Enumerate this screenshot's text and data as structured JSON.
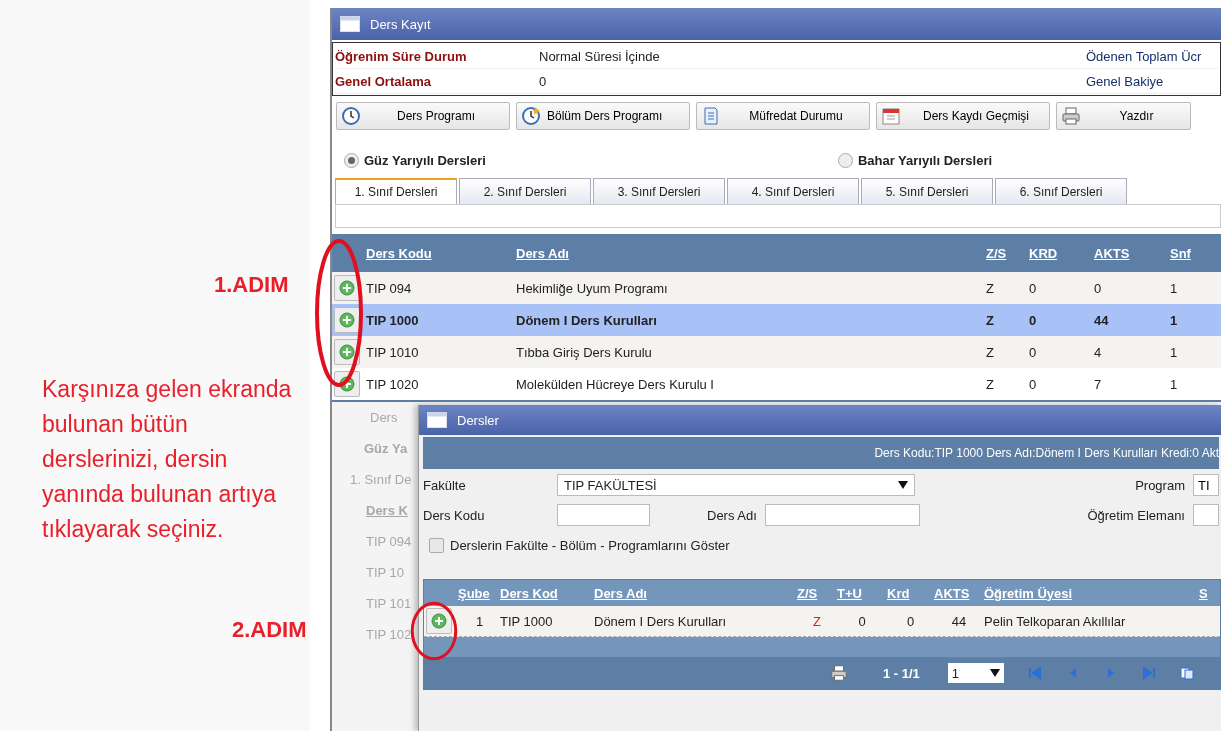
{
  "annotations": {
    "step_1": "1.ADIM",
    "step_2": "2.ADIM",
    "instruction": "Karşınıza gelen ekranda bulunan bütün derslerinizi, dersin yanında bulunan artıya tıklayarak seçiniz."
  },
  "window": {
    "title": "Ders Kayıt"
  },
  "info": [
    {
      "label": "Öğrenim Süre Durum",
      "value": "Normal Süresi İçinde",
      "right": "Ödenen Toplam Ücr"
    },
    {
      "label": "Genel Ortalama",
      "value": "0",
      "right": "Genel Bakiye"
    }
  ],
  "toolbar": [
    {
      "label": "Ders Programı",
      "kind": "clock"
    },
    {
      "label": "Bölüm Ders Programı",
      "kind": "clock-star"
    },
    {
      "label": "Müfredat Durumu",
      "kind": "document"
    },
    {
      "label": "Ders Kaydı Geçmişi",
      "kind": "calendar"
    },
    {
      "label": "Yazdır",
      "kind": "printer"
    }
  ],
  "semesters": [
    {
      "label": "Güz Yarıyılı Dersleri",
      "selected": true
    },
    {
      "label": "Bahar Yarıyılı Dersleri",
      "selected": false
    }
  ],
  "tabs": [
    {
      "label": "1. Sınıf Dersleri",
      "selected": true
    },
    {
      "label": "2. Sınıf Dersleri",
      "selected": false
    },
    {
      "label": "3. Sınıf Dersleri",
      "selected": false
    },
    {
      "label": "4. Sınıf Dersleri",
      "selected": false
    },
    {
      "label": "5. Sınıf Dersleri",
      "selected": false
    },
    {
      "label": "6. Sınıf Dersleri",
      "selected": false
    }
  ],
  "table": {
    "columns": [
      "Ders Kodu",
      "Ders Adı",
      "Z/S",
      "KRD",
      "AKTS",
      "Snf"
    ],
    "rows": [
      {
        "cells": [
          "TIP 094",
          "Hekimliğe Uyum Programı",
          "Z",
          "0",
          "0",
          "1"
        ],
        "selected": false
      },
      {
        "cells": [
          "TIP 1000",
          "Dönem I Ders Kurulları",
          "Z",
          "0",
          "44",
          "1"
        ],
        "selected": true
      },
      {
        "cells": [
          "TIP 1010",
          "Tıbba Giriş Ders Kurulu",
          "Z",
          "0",
          "4",
          "1"
        ],
        "selected": false
      },
      {
        "cells": [
          "TIP 1020",
          "Molekülden Hücreye Ders Kurulu I",
          "Z",
          "0",
          "7",
          "1"
        ],
        "selected": false
      }
    ]
  },
  "background_fragments": {
    "button": "Ders",
    "radio": "Güz Ya",
    "tab": "1. Sınıf De",
    "header": "Ders K",
    "rows": [
      "TIP 094",
      "TIP 10",
      "TIP 101",
      "TIP 102"
    ]
  },
  "dialog": {
    "title": "Dersler",
    "info": "Ders Kodu:TIP 1000 Ders Adı:Dönem I Ders Kurulları Kredi:0 Akt",
    "faculty_label": "Fakülte",
    "faculty_value": "TIP FAKÜLTESİ",
    "program_label": "Program",
    "program_value": "TI",
    "code_label": "Ders Kodu",
    "name_label": "Ders Adı",
    "teacher_label": "Öğretim Elemanı",
    "show_checkbox": {
      "label": "Derslerin Fakülte - Bölüm - Programlarını Göster",
      "checked": false
    },
    "columns": [
      "Şube",
      "Ders Kod",
      "Ders Adı",
      "Z/S",
      "T+U",
      "Krd",
      "AKTS",
      "Öğretim Üyesi",
      "S"
    ],
    "rows": [
      {
        "cells": [
          "1",
          "TIP 1000",
          "Dönem I Ders Kurulları",
          "Z",
          "0",
          "0",
          "44",
          "Pelin Telkoparan Akıllılar"
        ]
      }
    ],
    "pager": {
      "range": "1 - 1/1",
      "page": "1"
    }
  }
}
